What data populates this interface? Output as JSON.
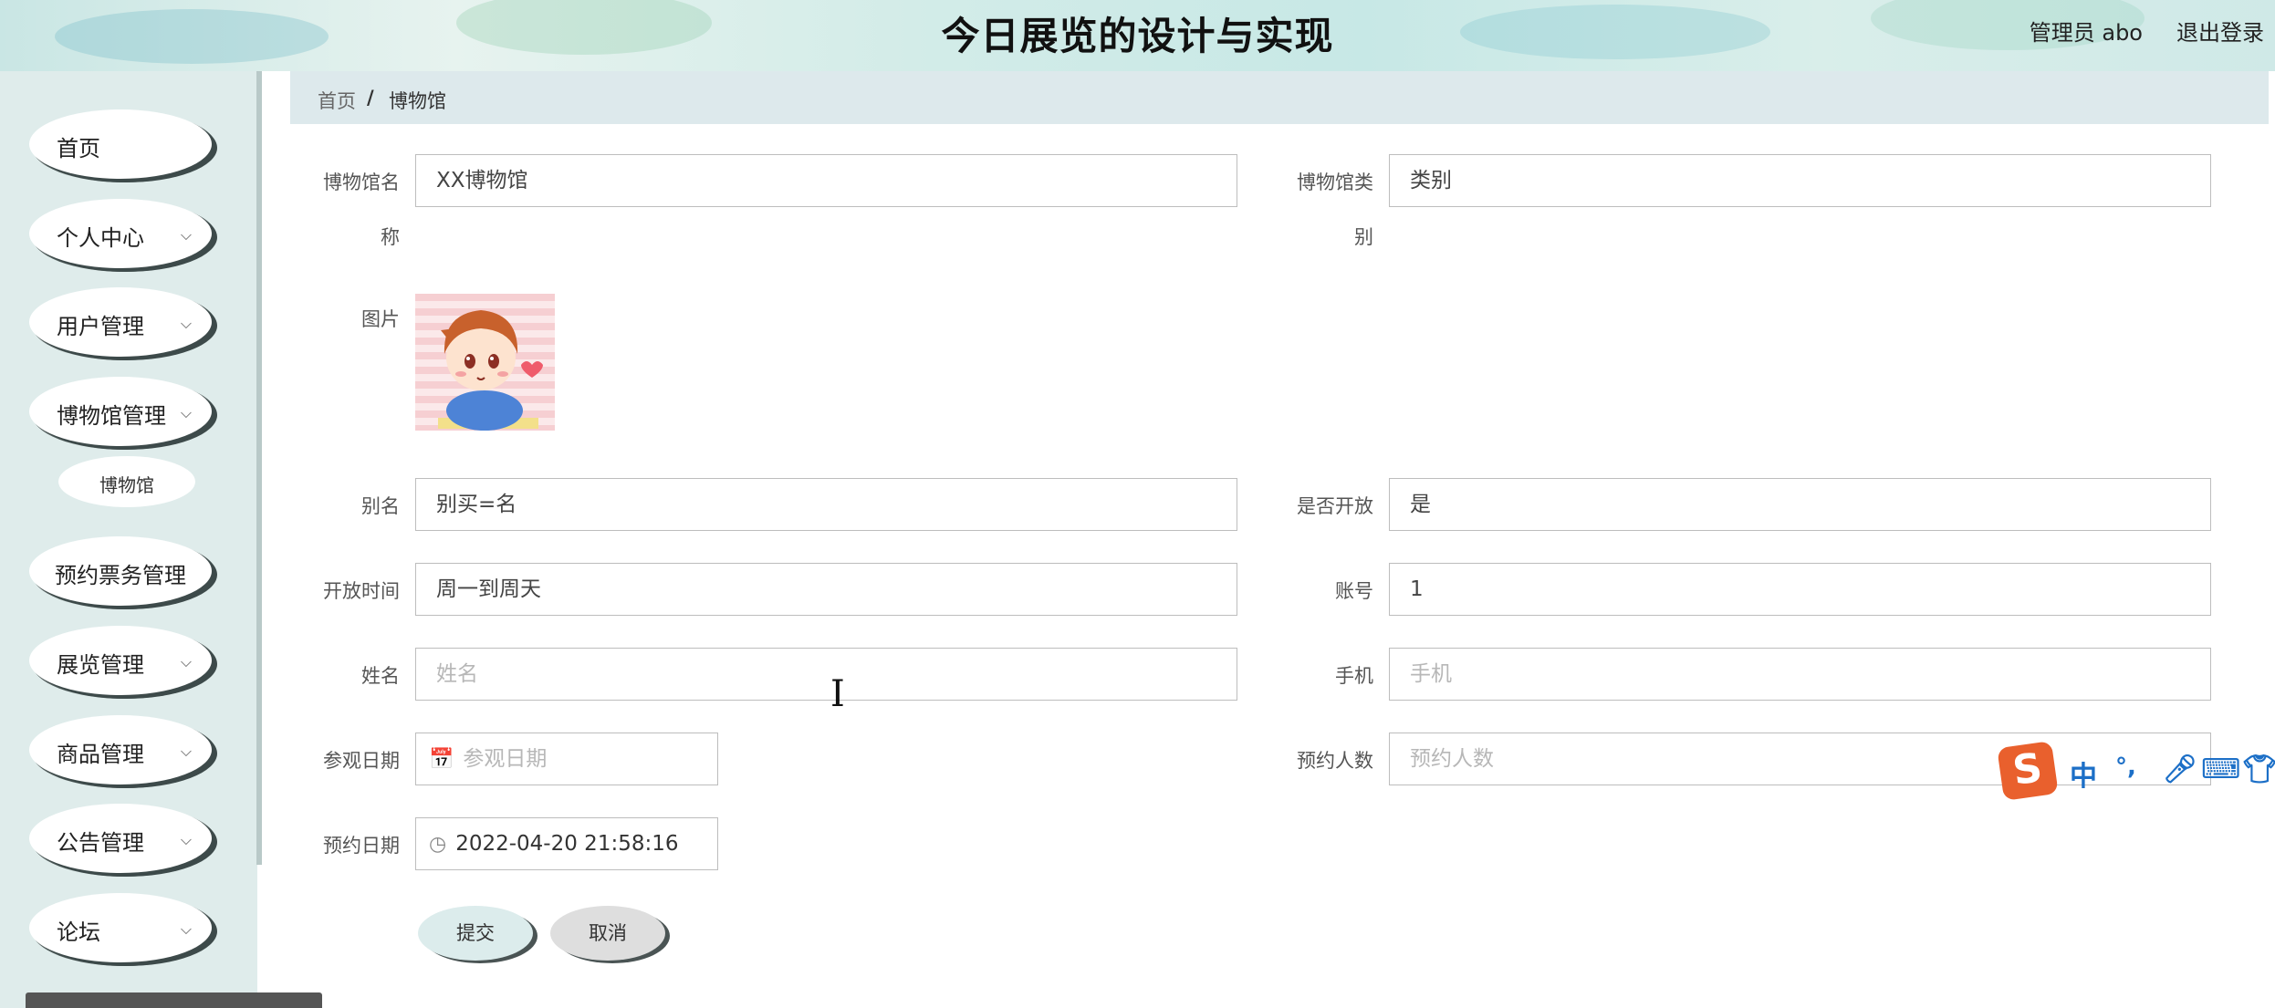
{
  "header": {
    "title": "今日展览的设计与实现",
    "user_label": "管理员 abo",
    "logout": "退出登录"
  },
  "sidebar": {
    "items": [
      {
        "label": "首页",
        "chevron": false
      },
      {
        "label": "个人中心",
        "chevron": true
      },
      {
        "label": "用户管理",
        "chevron": true
      },
      {
        "label": "博物馆管理",
        "chevron": true
      },
      {
        "label": "预约票务管理",
        "chevron": false
      },
      {
        "label": "展览管理",
        "chevron": true
      },
      {
        "label": "商品管理",
        "chevron": true
      },
      {
        "label": "公告管理",
        "chevron": true
      },
      {
        "label": "论坛",
        "chevron": true
      }
    ],
    "sub_item": "博物馆"
  },
  "breadcrumb": {
    "home": "首页",
    "separator": "/",
    "current": "博物馆"
  },
  "form": {
    "museum_name": {
      "label_line1": "博物馆名",
      "label_line2": "称",
      "value": "XX博物馆"
    },
    "museum_type": {
      "label_line1": "博物馆类",
      "label_line2": "别",
      "value": "类别"
    },
    "image": {
      "label": "图片"
    },
    "alias": {
      "label": "别名",
      "value": "别买=名"
    },
    "is_open": {
      "label": "是否开放",
      "value": "是"
    },
    "open_time": {
      "label": "开放时间",
      "value": "周一到周天"
    },
    "account": {
      "label": "账号",
      "value": "1"
    },
    "name": {
      "label": "姓名",
      "placeholder": "姓名"
    },
    "phone": {
      "label": "手机",
      "placeholder": "手机"
    },
    "visit_date": {
      "label": "参观日期",
      "placeholder": "参观日期"
    },
    "reserve_count": {
      "label": "预约人数",
      "placeholder": "预约人数"
    },
    "reserve_date": {
      "label": "预约日期",
      "value": "2022-04-20 21:58:16"
    },
    "submit": "提交",
    "cancel": "取消"
  },
  "ime": {
    "logo": "S",
    "mode": "中",
    "punct": "°,"
  }
}
